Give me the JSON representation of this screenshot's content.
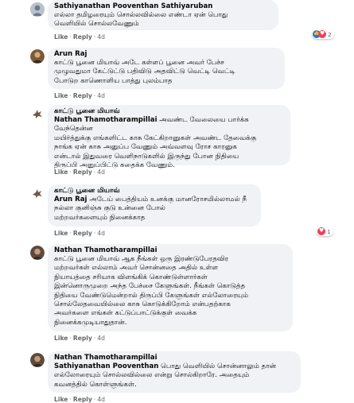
{
  "colors": {
    "bubble": "#f0f2f5",
    "meta": "#65676b",
    "like_blue": "#1877f2",
    "love_red": "#f33e58"
  },
  "comments": [
    {
      "author": "Sathiyanathan Pooventhan Sathiyaruban",
      "lines": [
        "எல்லா தமிழரையும் சொல்லவில்லை எண்டா ஏன் பொது",
        "வெளியில் சொல்லவேணும்"
      ],
      "like": "Like",
      "reply": "Reply",
      "time": "4d",
      "reactions": {
        "icons": [
          "like-icon",
          "love-icon"
        ],
        "count": "2"
      }
    },
    {
      "author": "Arun Raj",
      "lines": [
        "காட்டு பூனை மியாவ் அடே கள்ளப் பூனை அவர் பேச்ச",
        "முழுவதுமா கேட்டுட்டு பதிவிடு அதவிட்டு வெட்டி வெட்டி",
        "போடுற காணொளிய பாத்து புலம்பாத"
      ],
      "like": "Like",
      "reply": "Reply",
      "time": "4d"
    },
    {
      "author": "காட்டு பூனை மியாவ்",
      "mention": "Nathan Thamotharampillai",
      "lines": [
        " அவண்ட வேலையை பார்க்க வேந்தென்ன",
        "மயிர்த்துக்கு எங்களிட்ட காசு கேட்கிறானுகள் அவண்ட தேவைக்கு",
        "நாங்க ஏன் காசு அனுப்ப வேணும் அவ்வளவு ரோச காரனுக",
        "என்டால் இதுவரை வெளிநாடுகளில் இருந்து போன நிதியை",
        "திருப்பி அனுப்பிட்டு கதைக்க வேணும்."
      ],
      "like": "Like",
      "reply": "Reply",
      "time": "4d"
    },
    {
      "author": "காட்டு பூனை மியாவ்",
      "mention": "Arun Raj",
      "lines": [
        " அடேய் பைத்தியம் உனக்கு மானரோசமில்லாமல் நீ",
        "நல்லா குனிஞ்சு குடு உன்னை போல்",
        "மற்றவர்களையும் நினைக்காத"
      ],
      "like": "Like",
      "reply": "Reply",
      "time": "4d",
      "reactions": {
        "icons": [
          "love-icon"
        ],
        "count": "1"
      }
    },
    {
      "author": "Nathan Thamotharampillai",
      "lines": [
        "காட்டு பூனை மியாவ் ஆக நீங்கள் ஒரு இரண்டுபேரதவிர",
        "மற்றவர்கள் எல்லாம் அவர் சொன்னதை அதில் உள்ள",
        "நியாயத்தை சரியாக விளங்கிக் கொண்டுள்ளார்கள்",
        "இன்னொருமுறை அந்த பேச்சை கேளுங்கள். நீங்கள் கொடுத்த",
        "நிதியை வேண்டுமென்றால் திருப்பி கேளுங்கள் எல்லோரையும்",
        "சொல்லேதவையில்லை காசு கொடுக்கிறோம் என்பதற்காக",
        "அவர்களை எங்கள் கட்டுப்பாட்டுக்குள் வைக்க",
        "நினைக்கமுடியாதுதான்."
      ],
      "like": "Like",
      "reply": "Reply",
      "time": "4d"
    },
    {
      "author": "Nathan Thamotharampillai",
      "mention": "Sathiyanathan Pooventhan",
      "lines": [
        " பொது வெளியில் சொன்னாலும் தான்",
        "எல்லோரையும் சொல்லவில்லை என்று சொல்கிறாரே. அதையும்",
        "கவனத்தில் கொள்ளுங்கள்."
      ],
      "like": "Like",
      "reply": "Reply",
      "time": "4d"
    }
  ]
}
